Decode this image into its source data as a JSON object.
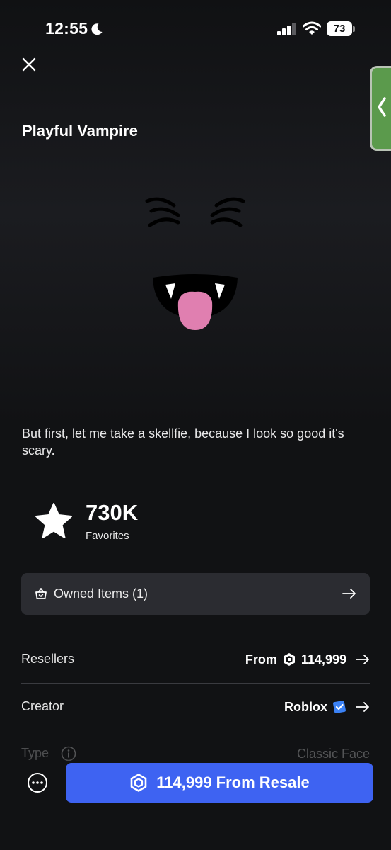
{
  "status_bar": {
    "time": "12:55",
    "battery": "73",
    "icons": [
      "moon-icon",
      "signal-icon",
      "wifi-icon",
      "battery-icon"
    ]
  },
  "header": {
    "close_icon": "close-icon",
    "side_tab_icon": "chevron-left-icon"
  },
  "item": {
    "title": "Playful Vampire",
    "description": "But first, let me take a skellfie, because I look so good it's scary."
  },
  "favorites": {
    "count": "730K",
    "label": "Favorites",
    "icon": "star-icon"
  },
  "owned_items": {
    "label": "Owned Items (1)",
    "icon": "basket-icon"
  },
  "details": {
    "resellers": {
      "label": "Resellers",
      "prefix": "From",
      "price": "114,999"
    },
    "creator": {
      "label": "Creator",
      "value": "Roblox"
    },
    "type": {
      "label": "Type",
      "value": "Classic Face"
    }
  },
  "actions": {
    "buy_label": "114,999 From Resale",
    "more_icon": "more-horizontal-icon"
  },
  "colors": {
    "background": "#111214",
    "card": "#2b2c31",
    "accent": "#3e63f2",
    "verified": "#3b82f6",
    "side_tab": "#5b9a4c",
    "tongue": "#e07fb0"
  }
}
